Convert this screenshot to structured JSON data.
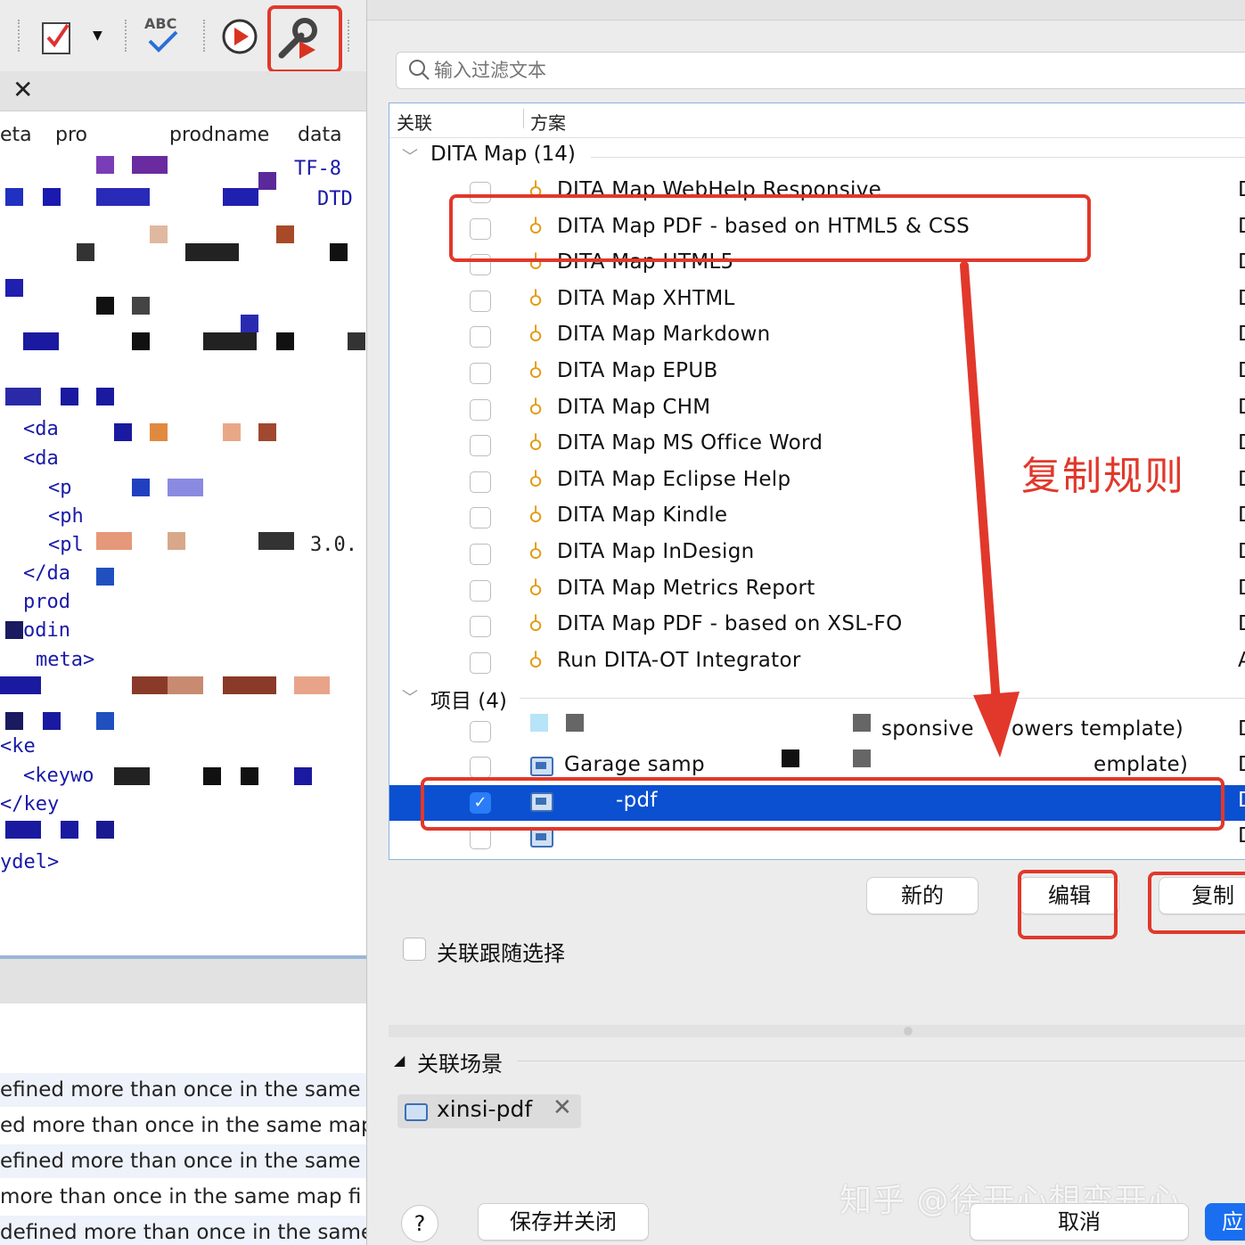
{
  "left_editor": {
    "columns": [
      "eta",
      "pro",
      "prodname",
      "data"
    ],
    "code_lines": [
      "TF-8",
      "DTD",
      "<da",
      "<da",
      "<p",
      "<ph",
      "<pl",
      "3.0.",
      "</da",
      "prod",
      "odin",
      "meta>",
      "<ke",
      "<keywo",
      "</key",
      "ydel>"
    ],
    "messages": [
      "efined more than once in the same",
      "ed more than once in the same map",
      "efined more than once in the same",
      "more than once in the same map fi",
      "defined more than once in the same"
    ]
  },
  "dialog": {
    "filter_placeholder": "输入过滤文本",
    "headers": {
      "assoc": "关联",
      "scheme": "方案"
    },
    "groups": {
      "dita_map": {
        "label": "DITA Map (14)"
      },
      "project": {
        "label": "项目 (4)"
      }
    },
    "dita_rows": [
      {
        "name": "DITA Map WebHelp Responsive",
        "last": "D"
      },
      {
        "name": "DITA Map PDF - based on HTML5 & CSS",
        "last": "D"
      },
      {
        "name": "DITA Map HTML5",
        "last": "D"
      },
      {
        "name": "DITA Map XHTML",
        "last": "D"
      },
      {
        "name": "DITA Map Markdown",
        "last": "D"
      },
      {
        "name": "DITA Map EPUB",
        "last": "D"
      },
      {
        "name": "DITA Map CHM",
        "last": "D"
      },
      {
        "name": "DITA Map MS Office Word",
        "last": "D"
      },
      {
        "name": "DITA Map Eclipse Help",
        "last": "D"
      },
      {
        "name": "DITA Map Kindle",
        "last": "D"
      },
      {
        "name": "DITA Map InDesign",
        "last": "D"
      },
      {
        "name": "DITA Map Metrics Report",
        "last": "D"
      },
      {
        "name": "DITA Map PDF - based on XSL-FO",
        "last": "D"
      },
      {
        "name": "Run DITA-OT Integrator",
        "last": "A"
      }
    ],
    "project_rows": [
      {
        "name": "sponsive",
        "name2": "owers template)",
        "last": "D"
      },
      {
        "name": "Garage samp",
        "name2": "emplate)",
        "last": "D"
      },
      {
        "name": "-pdf",
        "last": "D",
        "checked": true
      },
      {
        "name": "",
        "last": "D"
      }
    ],
    "buttons": {
      "new": "新的",
      "edit": "编辑",
      "copy": "复制"
    },
    "follow_selection_label": "关联跟随选择",
    "scenarios_label": "关联场景",
    "scenario_chip": "xinsi-pdf",
    "footer": {
      "help": "?",
      "save_close": "保存并关闭",
      "cancel": "取消",
      "apply": "应"
    },
    "annotation": "复制规则",
    "watermark": "知乎 @徐开心想变开心",
    "colors": {
      "selection": "#0b50d0",
      "annotation_red": "#e1382b",
      "key_icon": "#e29b13"
    }
  }
}
